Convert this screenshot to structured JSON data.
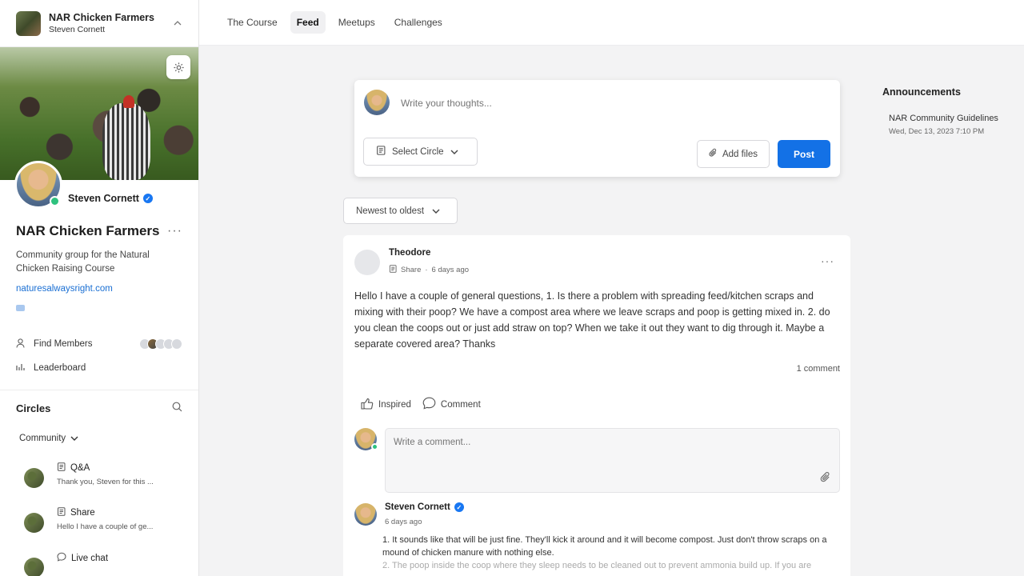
{
  "sidebar": {
    "group_title": "NAR Chicken Farmers",
    "group_user": "Steven Cornett",
    "profile_name": "Steven Cornett",
    "community_name": "NAR Chicken Farmers",
    "community_desc": "Community group for the Natural Chicken Raising Course",
    "community_link": "naturesalwaysright.com",
    "links": [
      {
        "label": "Find Members",
        "icon": "person-icon"
      },
      {
        "label": "Leaderboard",
        "icon": "bar-chart-icon"
      }
    ],
    "circles_title": "Circles",
    "circles_filter": "Community",
    "circles": [
      {
        "title": "Q&A",
        "preview": "Thank you, Steven for this ...",
        "icon": "post-icon"
      },
      {
        "title": "Share",
        "preview": "Hello I have a couple of ge...",
        "icon": "post-icon"
      },
      {
        "title": "Live chat",
        "preview": "",
        "icon": "chat-icon"
      }
    ]
  },
  "nav": {
    "tabs": [
      "The Course",
      "Feed",
      "Meetups",
      "Challenges"
    ],
    "active": "Feed"
  },
  "composer": {
    "placeholder": "Write your thoughts...",
    "select_circle": "Select Circle",
    "add_files": "Add files",
    "post": "Post"
  },
  "sort": {
    "selected": "Newest to oldest"
  },
  "post": {
    "author": "Theodore",
    "circle": "Share",
    "time": "6 days ago",
    "body": "Hello I have a couple of general questions, 1. Is there a problem with spreading feed/kitchen scraps and mixing with their poop? We have a compost area where we leave scraps and poop is getting mixed in. 2. do you clean the coops out or just add straw on top? When we take it out they want to dig through it. Maybe a separate covered area? Thanks",
    "comment_count": "1 comment",
    "actions": {
      "inspired": "Inspired",
      "comment": "Comment"
    },
    "comment_placeholder": "Write a comment...",
    "reply": {
      "author": "Steven Cornett",
      "time": "6 days ago",
      "line1": "1. It sounds like that will be just fine. They'll kick it around and it will become compost. Just don't throw scraps on a mound of chicken manure with nothing else.",
      "line2": "2. The poop inside the coop where they sleep needs to be cleaned out to prevent ammonia build up. If you are"
    }
  },
  "announcements": {
    "title": "Announcements",
    "items": [
      {
        "title": "NAR Community Guidelines",
        "date": "Wed, Dec 13, 2023 7:10 PM"
      }
    ]
  },
  "colors": {
    "accent": "#1371e6",
    "online": "#2ec27e",
    "link": "#1a6fd3"
  }
}
